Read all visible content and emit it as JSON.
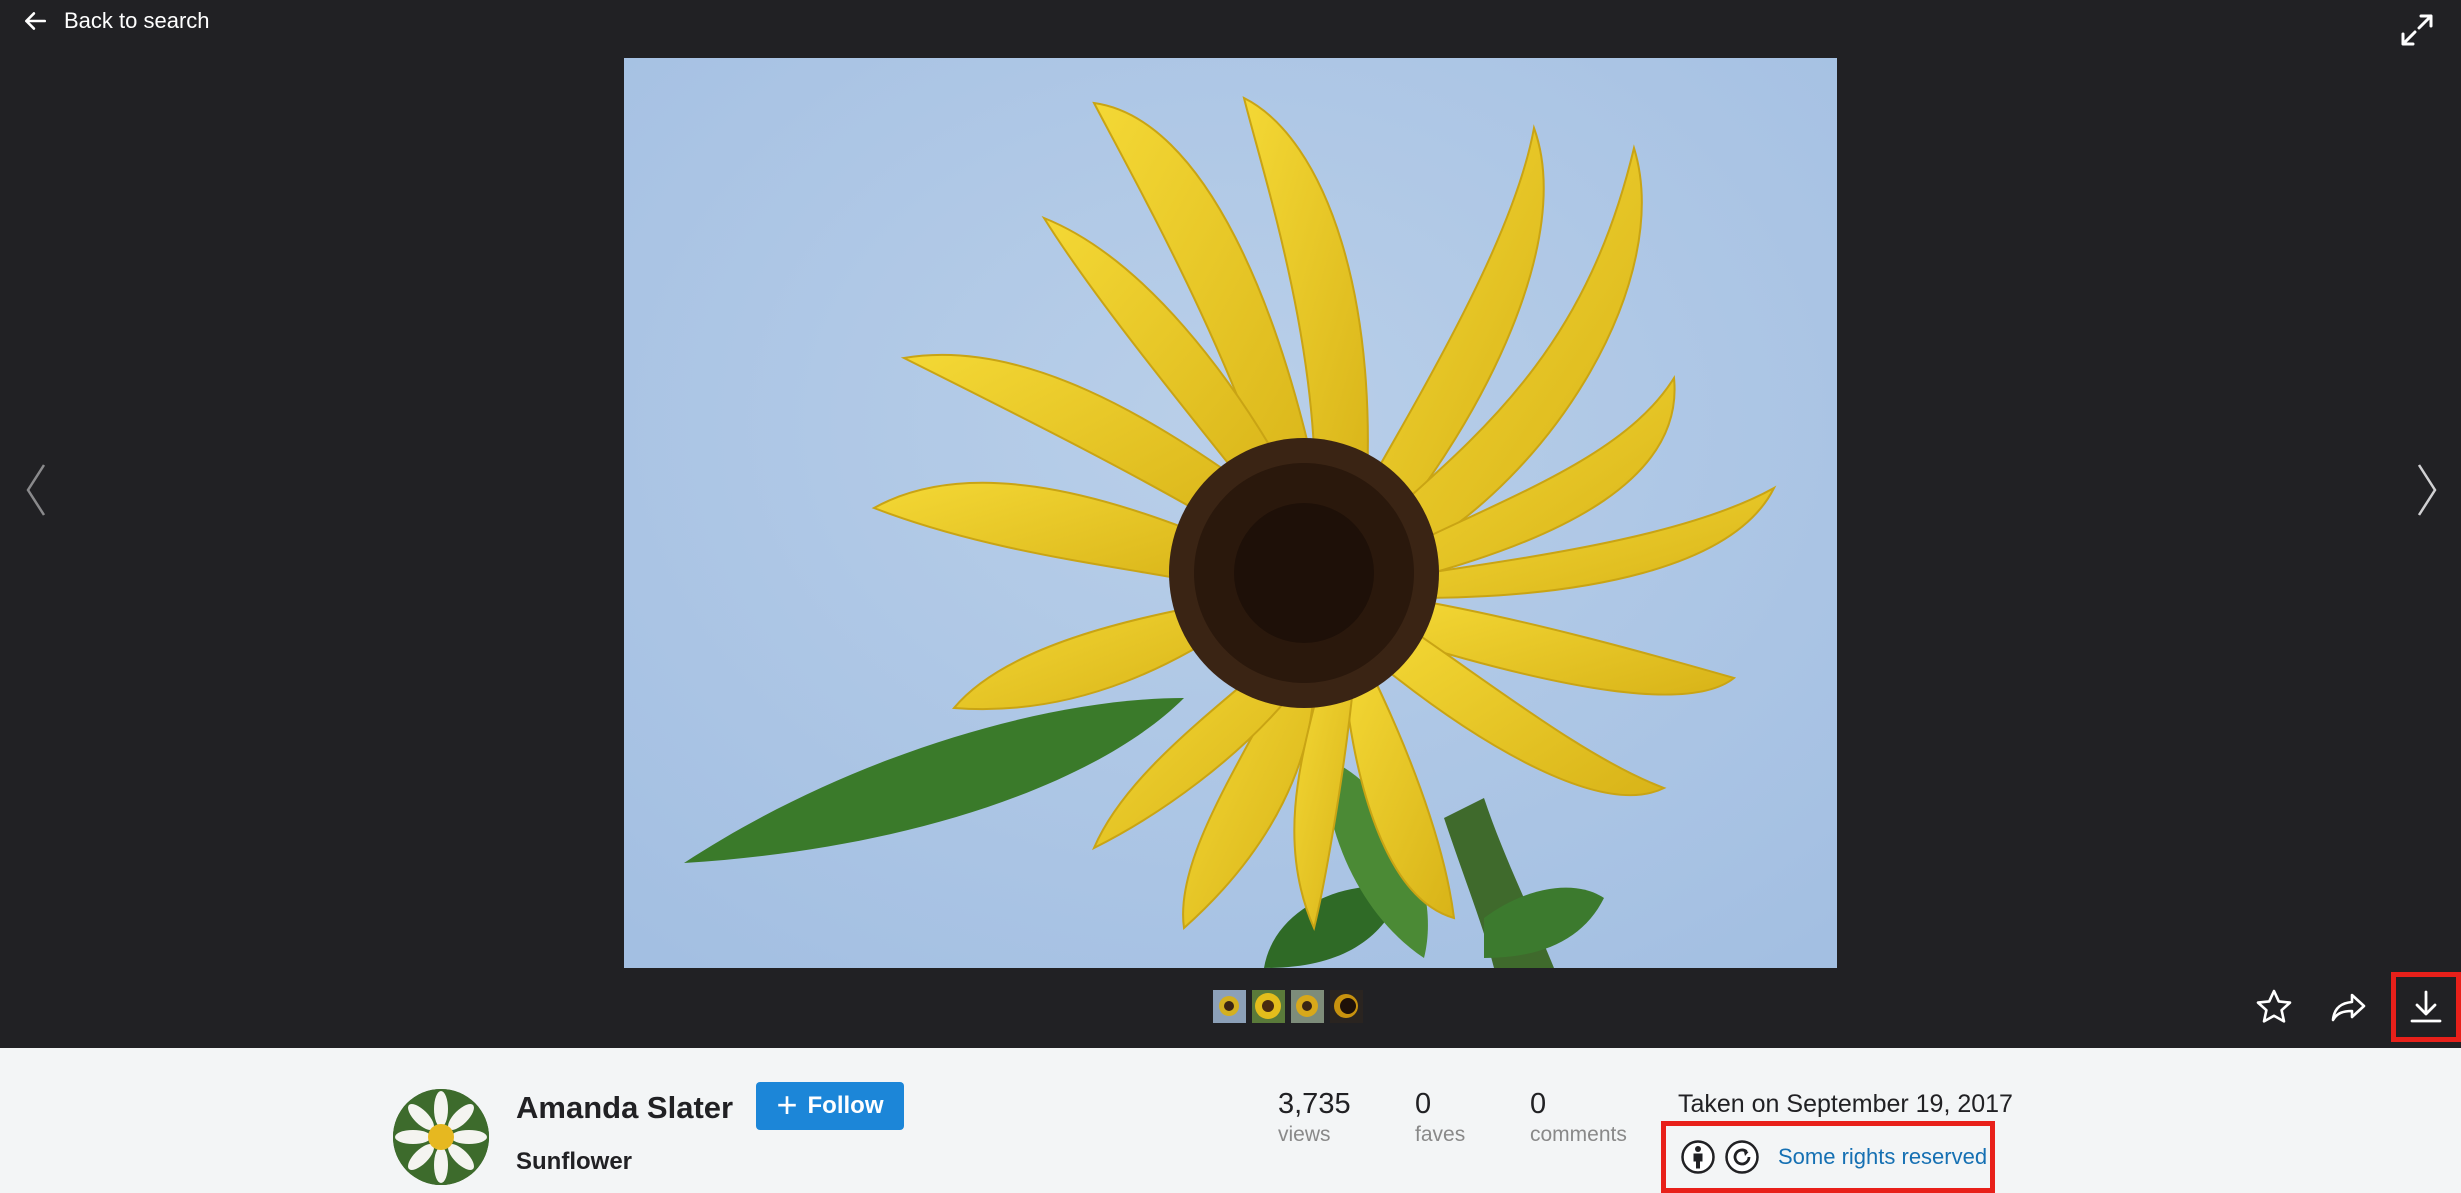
{
  "nav": {
    "back_label": "Back to search"
  },
  "photo": {
    "subject": "sunflower"
  },
  "thumbnails": [
    {
      "name": "thumb-1"
    },
    {
      "name": "thumb-2"
    },
    {
      "name": "thumb-3"
    },
    {
      "name": "thumb-4"
    }
  ],
  "author": {
    "name": "Amanda Slater",
    "follow_label": "Follow",
    "photo_title": "Sunflower"
  },
  "stats": {
    "views_count": "3,735",
    "views_label": "views",
    "faves_count": "0",
    "faves_label": "faves",
    "comments_count": "0",
    "comments_label": "comments"
  },
  "meta": {
    "taken": "Taken on September 19, 2017",
    "rights": "Some rights reserved"
  },
  "colors": {
    "viewer_bg": "#212124",
    "info_bg": "#f3f5f6",
    "follow_blue": "#1c86d8",
    "link_blue": "#1570b3",
    "highlight_red": "#e8201a"
  },
  "icons": [
    "arrow-left-icon",
    "fullscreen-icon",
    "chevron-left-icon",
    "chevron-right-icon",
    "star-icon",
    "share-icon",
    "download-icon",
    "attribution-icon",
    "share-alike-icon"
  ]
}
